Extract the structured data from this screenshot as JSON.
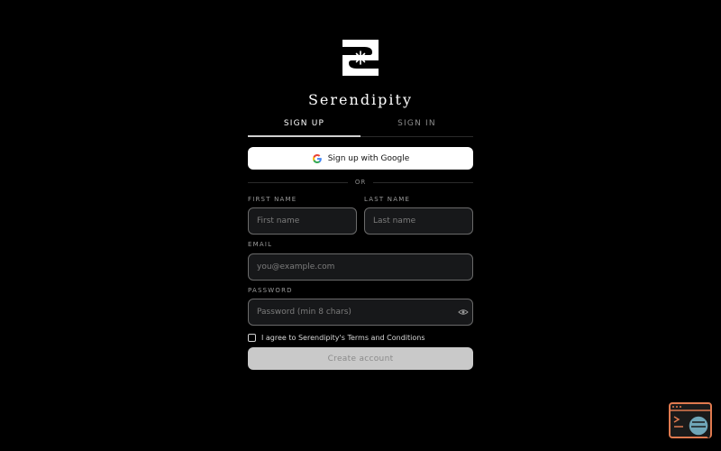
{
  "brand": {
    "name": "Serendipity",
    "logo_icon": "serendipity-logo-icon"
  },
  "tabs": [
    {
      "label": "SIGN UP",
      "active": true
    },
    {
      "label": "SIGN IN",
      "active": false
    }
  ],
  "google_button": {
    "label": "Sign up with Google",
    "icon": "google-icon"
  },
  "divider": {
    "label": "OR"
  },
  "form": {
    "first_name": {
      "label": "FIRST NAME",
      "placeholder": "First name",
      "value": ""
    },
    "last_name": {
      "label": "LAST NAME",
      "placeholder": "Last name",
      "value": ""
    },
    "email": {
      "label": "EMAIL",
      "placeholder": "you@example.com",
      "value": ""
    },
    "password": {
      "label": "PASSWORD",
      "placeholder": "Password (min 8 chars)",
      "value": "",
      "toggle_icon": "eye-icon"
    },
    "terms": {
      "label": "I agree to Serendipity's Terms and Conditions",
      "checked": false
    },
    "submit_label": "Create account"
  },
  "widget": {
    "icon": "assistant-widget-icon"
  },
  "colors": {
    "background": "#000000",
    "field_bg": "#17181a",
    "field_border": "#6a6a6a",
    "button_primary_bg": "#ffffff",
    "button_disabled_bg": "#c9c9c9",
    "widget_accent": "#e07a4f"
  }
}
